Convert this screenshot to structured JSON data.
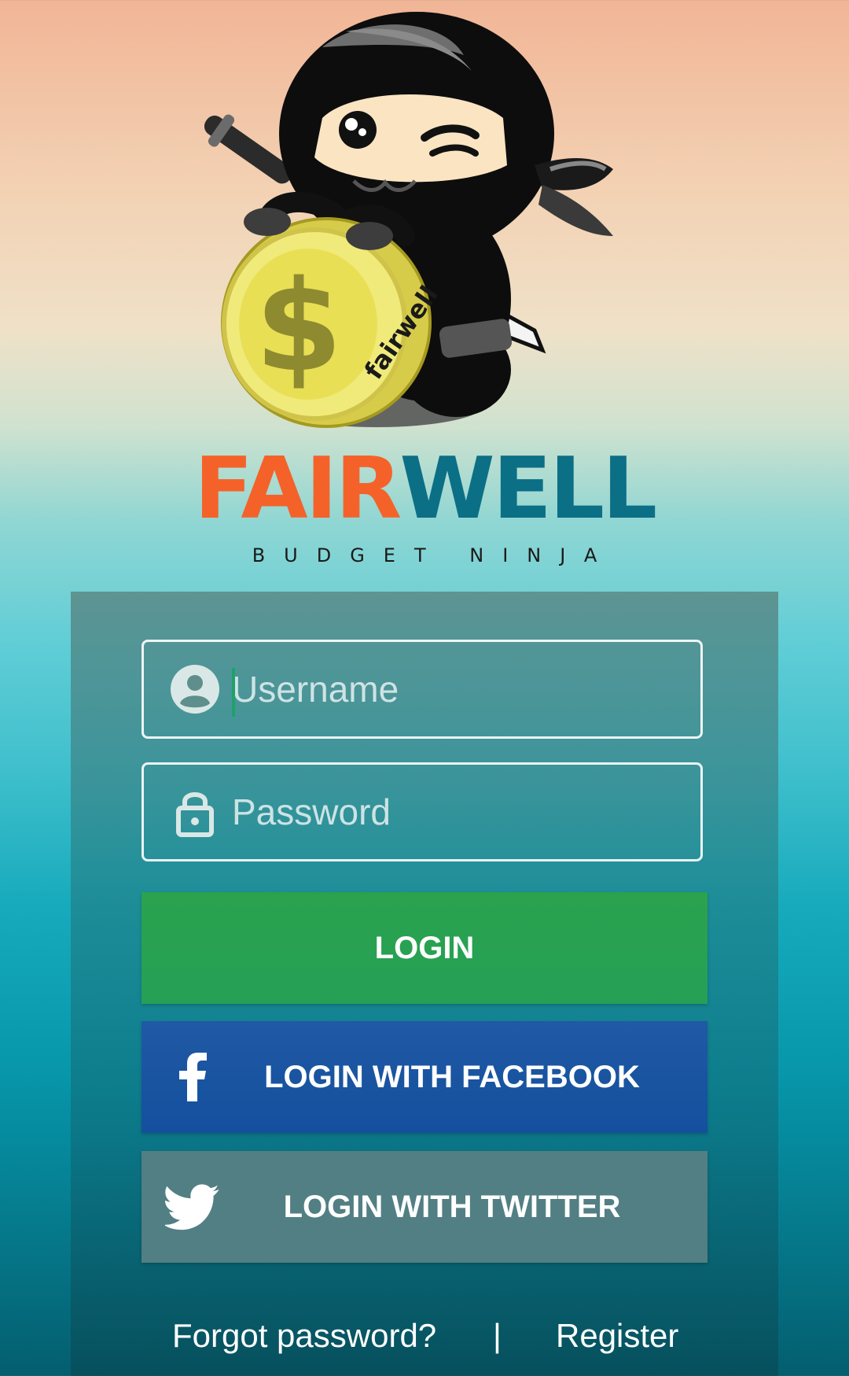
{
  "brand": {
    "name_part1": "FAIR",
    "name_part2": "WELL",
    "tagline": "BUDGET NINJA",
    "coin_text": "fairwell",
    "coin_symbol": "$",
    "colors": {
      "fair": "#f4622a",
      "well": "#0b6f86"
    }
  },
  "login_form": {
    "username": {
      "placeholder": "Username",
      "value": "",
      "icon": "user-circle-icon"
    },
    "password": {
      "placeholder": "Password",
      "value": "",
      "icon": "lock-icon"
    },
    "login_button": {
      "label": "LOGIN",
      "color": "#27a150"
    },
    "facebook_button": {
      "label": "LOGIN WITH FACEBOOK",
      "icon": "facebook-icon",
      "color": "#1a54a1"
    },
    "twitter_button": {
      "label": "LOGIN WITH TWITTER",
      "icon": "twitter-bird-icon",
      "color": "#527f83"
    },
    "links": {
      "forgot_password": "Forgot password?",
      "separator": "|",
      "register": "Register"
    }
  }
}
